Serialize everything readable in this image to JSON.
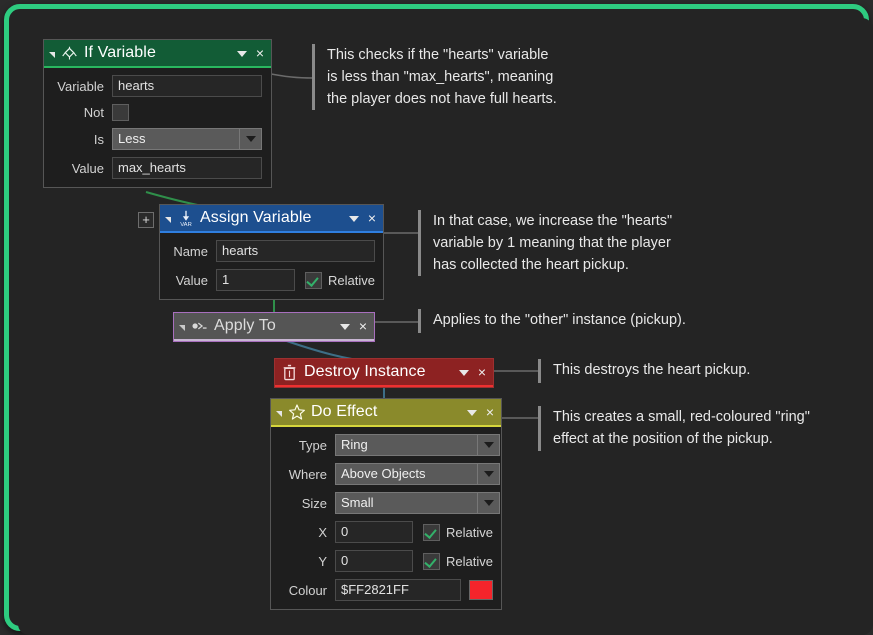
{
  "workspace": {
    "frame_accent": "#2ecc80",
    "canvas_bg": "#242424"
  },
  "blocks": [
    {
      "id": "if-variable",
      "title": "If Variable",
      "icon": "branch-diamond-icon",
      "header_color": "#125c36",
      "accent_color": "#29b85f",
      "rows": [
        {
          "label": "Variable",
          "type": "text",
          "value": "hearts"
        },
        {
          "label": "Not",
          "type": "checkbox",
          "checked": false
        },
        {
          "label": "Is",
          "type": "dropdown",
          "value": "Less"
        },
        {
          "label": "Value",
          "type": "text",
          "value": "max_hearts"
        }
      ]
    },
    {
      "id": "assign-variable",
      "title": "Assign Variable",
      "icon": "var-arrow-icon",
      "header_color": "#1d4f8f",
      "accent_color": "#2f7fe0",
      "plus_handle": "+",
      "rows": [
        {
          "label": "Name",
          "type": "text",
          "value": "hearts"
        },
        {
          "label": "Value",
          "type": "text",
          "value": "1",
          "relative_label": "Relative",
          "relative_checked": true
        }
      ]
    },
    {
      "id": "apply-to",
      "title": "Apply To",
      "icon": "target-instance-icon",
      "header_color": "#555555",
      "accent_color": "#c8b6d3",
      "border_color": "#a86fbe",
      "rows": []
    },
    {
      "id": "destroy-instance",
      "title": "Destroy Instance",
      "icon": "trash-icon",
      "header_color": "#8d2222",
      "accent_color": "#ee3030",
      "rows": []
    },
    {
      "id": "do-effect",
      "title": "Do Effect",
      "icon": "star-icon",
      "header_color": "#8a8a2b",
      "accent_color": "#d6d63c",
      "rows": [
        {
          "label": "Type",
          "type": "dropdown",
          "value": "Ring"
        },
        {
          "label": "Where",
          "type": "dropdown",
          "value": "Above Objects"
        },
        {
          "label": "Size",
          "type": "dropdown",
          "value": "Small"
        },
        {
          "label": "X",
          "type": "text",
          "value": "0",
          "relative_label": "Relative",
          "relative_checked": true
        },
        {
          "label": "Y",
          "type": "text",
          "value": "0",
          "relative_label": "Relative",
          "relative_checked": true
        },
        {
          "label": "Colour",
          "type": "color",
          "value": "$FF2821FF",
          "swatch": "#f4242b"
        }
      ]
    }
  ],
  "header_controls": {
    "collapse": "collapse-triangle",
    "dropdown": "chevron-down-icon",
    "close": "×"
  },
  "annotations": [
    {
      "id": "annot-if",
      "text": "This checks if the \"hearts\" variable\nis less than \"max_hearts\", meaning\nthe player does not have full hearts."
    },
    {
      "id": "annot-assign",
      "text": "In that case, we increase the \"hearts\"\nvariable by 1 meaning that the player\nhas collected the heart pickup."
    },
    {
      "id": "annot-apply",
      "text": "Applies to the \"other\" instance (pickup)."
    },
    {
      "id": "annot-destroy",
      "text": "This destroys the heart pickup."
    },
    {
      "id": "annot-effect",
      "text": "This creates a small, red-coloured \"ring\"\neffect at the position of the pickup."
    }
  ]
}
